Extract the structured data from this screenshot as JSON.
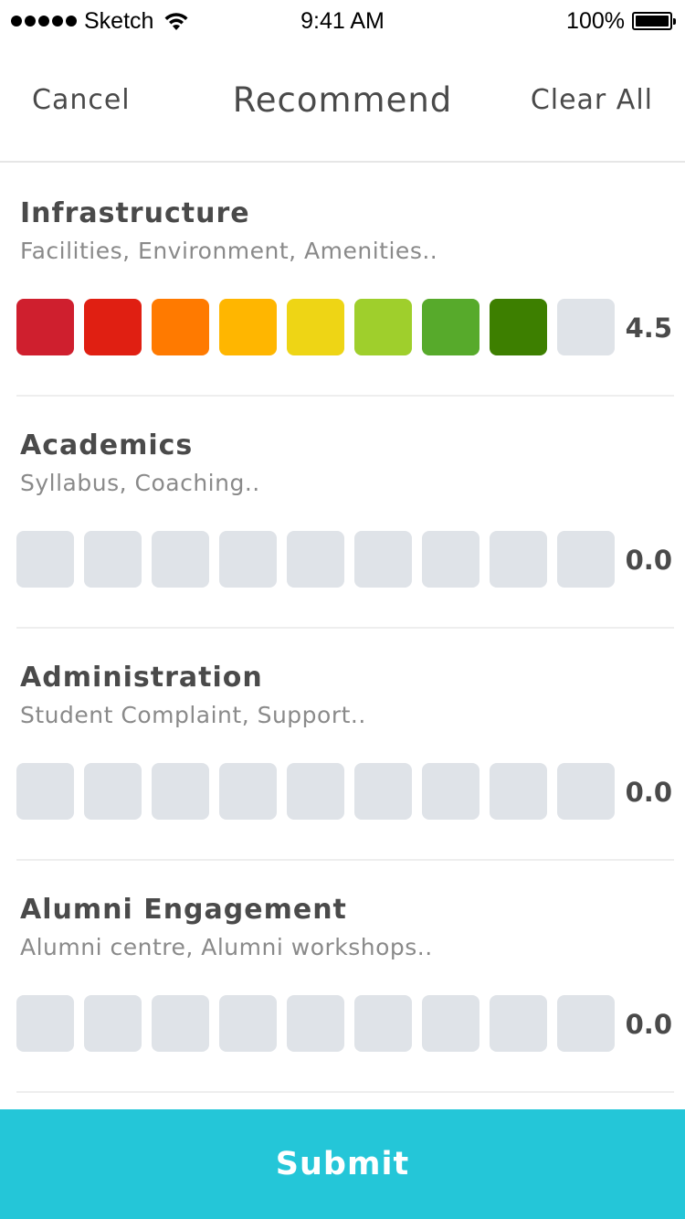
{
  "status_bar": {
    "carrier": "Sketch",
    "time": "9:41 AM",
    "battery": "100%"
  },
  "nav": {
    "cancel_label": "Cancel",
    "title": "Recommend",
    "clear_label": "Clear All"
  },
  "rating_colors": [
    "#cf1f2e",
    "#e01f12",
    "#ff7a00",
    "#ffb600",
    "#eed515",
    "#9fcf2c",
    "#57aa2b",
    "#3d7f00",
    "#dfe3e8"
  ],
  "empty_color": "#dfe3e8",
  "categories": [
    {
      "title": "Infrastructure",
      "subtitle": "Facilities, Environment, Amenities..",
      "filled": 8,
      "value": "4.5"
    },
    {
      "title": "Academics",
      "subtitle": "Syllabus, Coaching..",
      "filled": 0,
      "value": "0.0"
    },
    {
      "title": "Administration",
      "subtitle": "Student Complaint, Support..",
      "filled": 0,
      "value": "0.0"
    },
    {
      "title": "Alumni Engagement",
      "subtitle": "Alumni centre, Alumni workshops..",
      "filled": 0,
      "value": "0.0"
    }
  ],
  "submit_label": "Submit",
  "accent_color": "#24c6d8"
}
